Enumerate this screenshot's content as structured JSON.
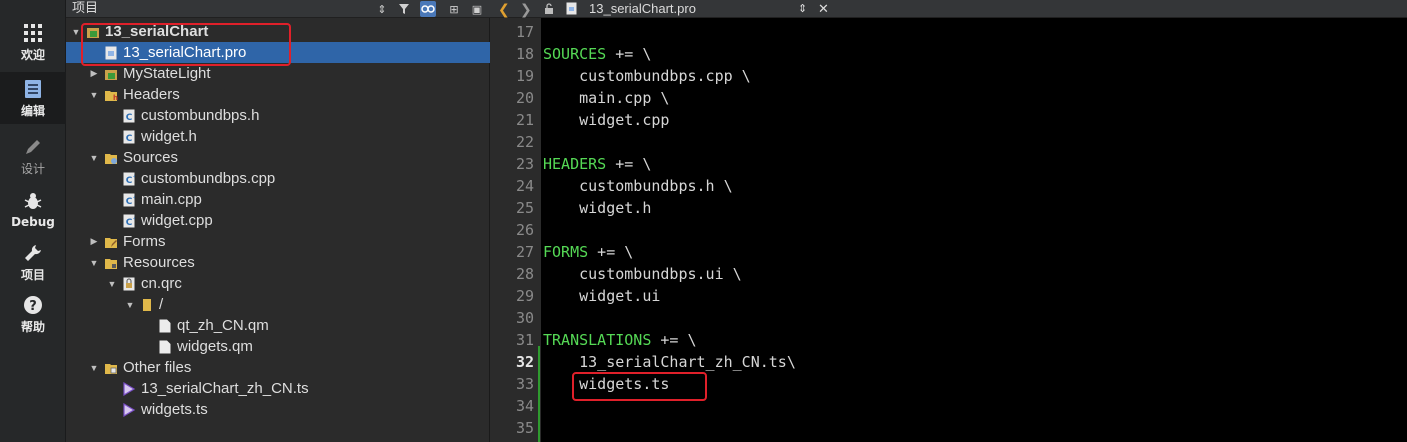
{
  "modebar": {
    "items": [
      {
        "label": "欢迎",
        "icon": "grid-icon"
      },
      {
        "label": "编辑",
        "icon": "document-icon"
      },
      {
        "label": "设计",
        "icon": "pencil-icon"
      },
      {
        "label": "Debug",
        "icon": "bug-icon"
      },
      {
        "label": "项目",
        "icon": "wrench-icon"
      },
      {
        "label": "帮助",
        "icon": "help-icon"
      }
    ],
    "active_index": 1
  },
  "project_pane": {
    "title": "项目",
    "tree": [
      {
        "label": "13_serialChart",
        "icon": "pro-file-icon",
        "expanded": true
      },
      {
        "label": "13_serialChart.pro",
        "icon": "pro-doc-icon",
        "selected": true
      },
      {
        "label": "MyStateLight",
        "icon": "pro-file-icon",
        "expanded": false
      },
      {
        "label": "Headers",
        "icon": "folder-h-icon",
        "expanded": true
      },
      {
        "label": "custombundbps.h",
        "icon": "c-header-icon"
      },
      {
        "label": "widget.h",
        "icon": "c-header-icon"
      },
      {
        "label": "Sources",
        "icon": "folder-src-icon",
        "expanded": true
      },
      {
        "label": "custombundbps.cpp",
        "icon": "cpp-source-icon"
      },
      {
        "label": "main.cpp",
        "icon": "cpp-source-icon"
      },
      {
        "label": "widget.cpp",
        "icon": "cpp-source-icon"
      },
      {
        "label": "Forms",
        "icon": "folder-forms-icon",
        "expanded": false
      },
      {
        "label": "Resources",
        "icon": "folder-res-icon",
        "expanded": true
      },
      {
        "label": "cn.qrc",
        "icon": "qrc-file-icon",
        "expanded": true
      },
      {
        "label": "/",
        "icon": "folder-icon",
        "expanded": true
      },
      {
        "label": "qt_zh_CN.qm",
        "icon": "plain-file-icon"
      },
      {
        "label": "widgets.qm",
        "icon": "plain-file-icon"
      },
      {
        "label": "Other files",
        "icon": "folder-other-icon",
        "expanded": true
      },
      {
        "label": "13_serialChart_zh_CN.ts",
        "icon": "ts-file-icon"
      },
      {
        "label": "widgets.ts",
        "icon": "ts-file-icon"
      }
    ]
  },
  "editor": {
    "filename": "13_serialChart.pro",
    "current_line": "32",
    "lines": [
      {
        "n": "17",
        "kw": "",
        "rest": ""
      },
      {
        "n": "18",
        "kw": "SOURCES",
        "rest": " += \\"
      },
      {
        "n": "19",
        "kw": "",
        "rest": "    custombundbps.cpp \\"
      },
      {
        "n": "20",
        "kw": "",
        "rest": "    main.cpp \\"
      },
      {
        "n": "21",
        "kw": "",
        "rest": "    widget.cpp"
      },
      {
        "n": "22",
        "kw": "",
        "rest": ""
      },
      {
        "n": "23",
        "kw": "HEADERS",
        "rest": " += \\"
      },
      {
        "n": "24",
        "kw": "",
        "rest": "    custombundbps.h \\"
      },
      {
        "n": "25",
        "kw": "",
        "rest": "    widget.h"
      },
      {
        "n": "26",
        "kw": "",
        "rest": ""
      },
      {
        "n": "27",
        "kw": "FORMS",
        "rest": " += \\"
      },
      {
        "n": "28",
        "kw": "",
        "rest": "    custombundbps.ui \\"
      },
      {
        "n": "29",
        "kw": "",
        "rest": "    widget.ui"
      },
      {
        "n": "30",
        "kw": "",
        "rest": ""
      },
      {
        "n": "31",
        "kw": "TRANSLATIONS",
        "rest": " += \\"
      },
      {
        "n": "32",
        "kw": "",
        "rest": "    13_serialChart_zh_CN.ts\\"
      },
      {
        "n": "33",
        "kw": "",
        "rest": "    widgets.ts"
      },
      {
        "n": "34",
        "kw": "",
        "rest": ""
      },
      {
        "n": "35",
        "kw": "",
        "rest": ""
      }
    ]
  },
  "colors": {
    "keyword": "#55d955",
    "selection": "#2f65a8",
    "annotation_box": "#e0202a"
  }
}
